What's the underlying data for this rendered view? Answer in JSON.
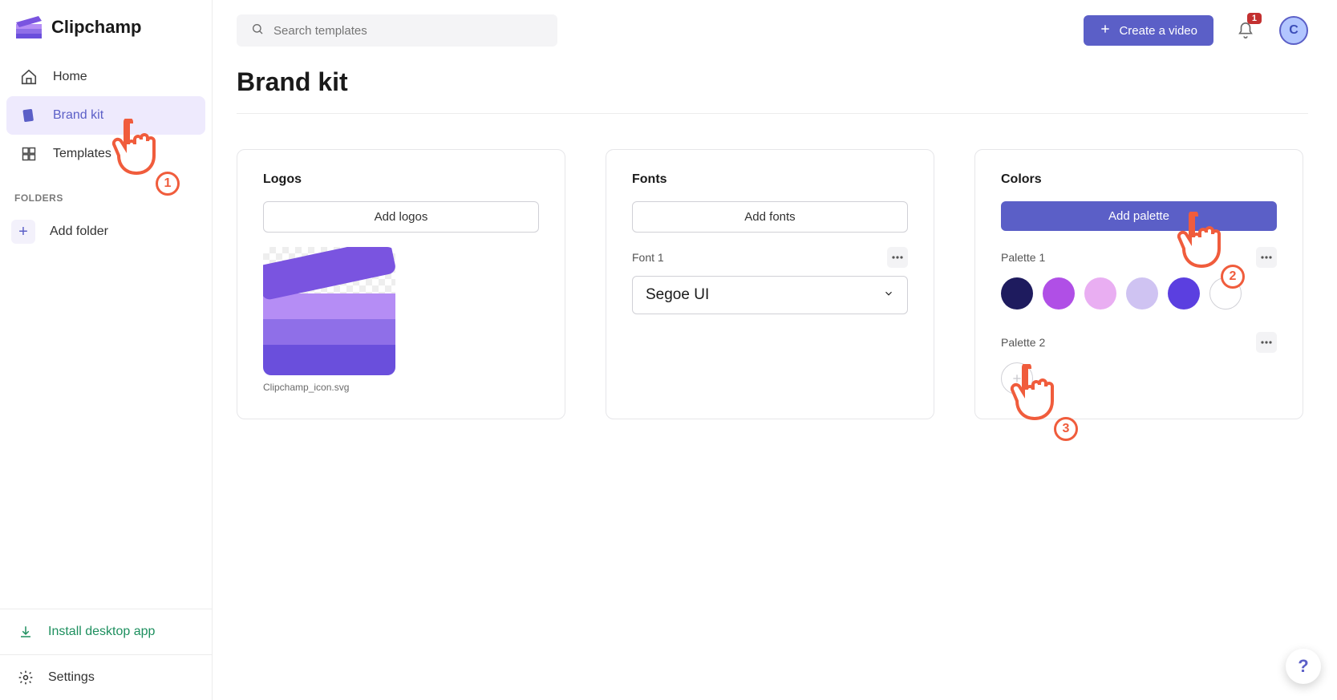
{
  "app_name": "Clipchamp",
  "search": {
    "placeholder": "Search templates"
  },
  "header": {
    "create_label": "Create a video",
    "notification_count": "1",
    "avatar_initial": "C"
  },
  "sidebar": {
    "nav": [
      {
        "label": "Home",
        "icon": "home-icon",
        "active": false
      },
      {
        "label": "Brand kit",
        "icon": "brandkit-icon",
        "active": true
      },
      {
        "label": "Templates",
        "icon": "templates-icon",
        "active": false
      }
    ],
    "folders_header": "FOLDERS",
    "add_folder": "Add folder",
    "install": "Install desktop app",
    "settings": "Settings"
  },
  "page": {
    "title": "Brand kit"
  },
  "logos": {
    "title": "Logos",
    "add_button": "Add logos",
    "items": [
      {
        "caption": "Clipchamp_icon.svg"
      }
    ]
  },
  "fonts": {
    "title": "Fonts",
    "add_button": "Add fonts",
    "rows": [
      {
        "label": "Font 1",
        "value": "Segoe UI"
      }
    ]
  },
  "colors": {
    "title": "Colors",
    "add_button": "Add palette",
    "palettes": [
      {
        "label": "Palette 1",
        "swatches": [
          "#1e1b5e",
          "#b04fe6",
          "#e9aef2",
          "#cfc3f2",
          "#5b3fe0",
          "#ffffff"
        ]
      },
      {
        "label": "Palette 2",
        "swatches": []
      }
    ]
  },
  "annotations": [
    {
      "n": "1"
    },
    {
      "n": "2"
    },
    {
      "n": "3"
    }
  ],
  "help_glyph": "?"
}
